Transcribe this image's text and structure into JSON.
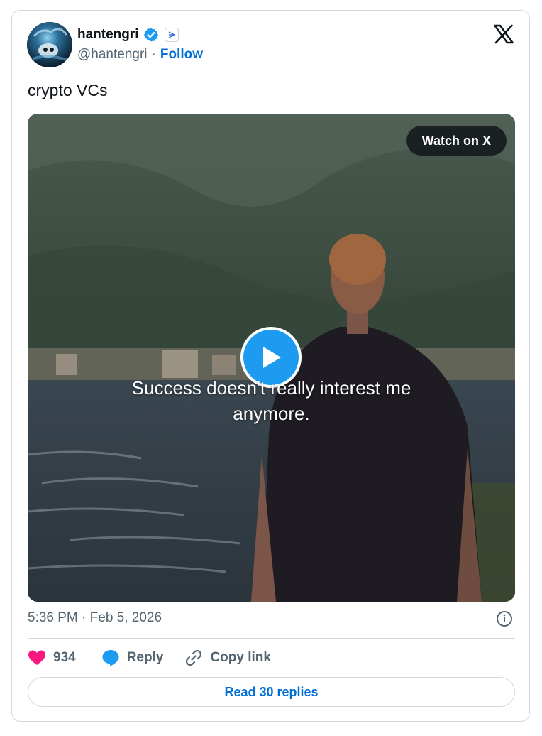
{
  "author": {
    "display_name": "hantengri",
    "handle": "@hantengri",
    "separator": "·",
    "follow_label": "Follow"
  },
  "tweet": {
    "text": "crypto VCs"
  },
  "media": {
    "watch_label": "Watch on X",
    "caption_line1": "Success doesn't really interest me",
    "caption_line2": "anymore."
  },
  "meta": {
    "timestamp": "5:36 PM · Feb 5, 2026"
  },
  "actions": {
    "like_count": "934",
    "reply_label": "Reply",
    "copy_label": "Copy link"
  },
  "footer": {
    "read_replies_label": "Read 30 replies"
  },
  "colors": {
    "accent": "#1d9bf0",
    "link": "#006fd6",
    "like": "#f91880",
    "muted": "#536471",
    "text": "#0f1419",
    "border": "#cfd9de"
  }
}
